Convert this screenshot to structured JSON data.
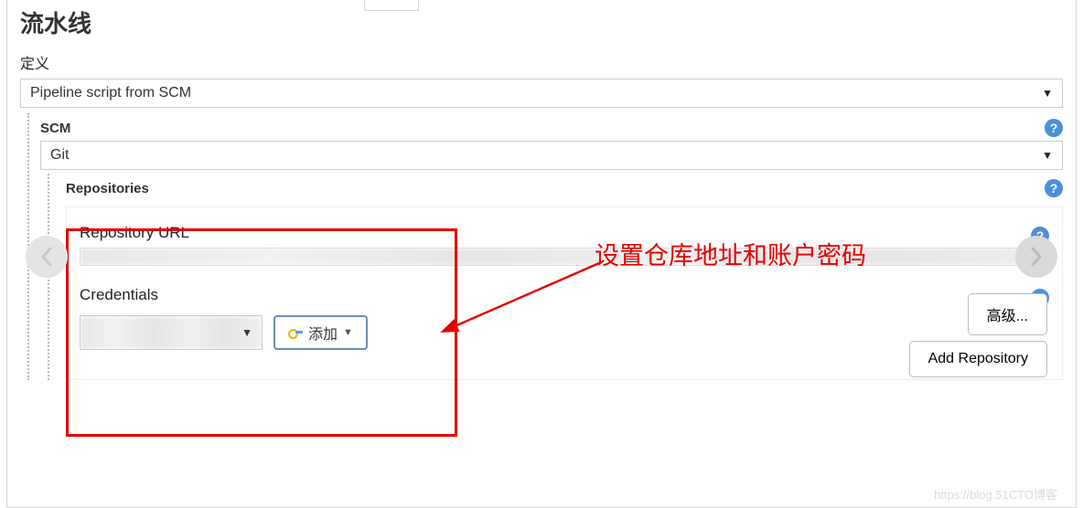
{
  "section_title": "流水线",
  "definition_label": "定义",
  "definition_value": "Pipeline script from SCM",
  "scm": {
    "label": "SCM",
    "value": "Git"
  },
  "repositories": {
    "label": "Repositories",
    "url_label": "Repository URL",
    "url_value": "",
    "credentials_label": "Credentials",
    "credentials_value": "",
    "add_label": "添加"
  },
  "buttons": {
    "advanced": "高级...",
    "add_repository": "Add Repository"
  },
  "annotation": "设置仓库地址和账户密码",
  "watermark": "https://blog.51CTO博客",
  "icons": {
    "help": "?",
    "caret": "▼"
  }
}
